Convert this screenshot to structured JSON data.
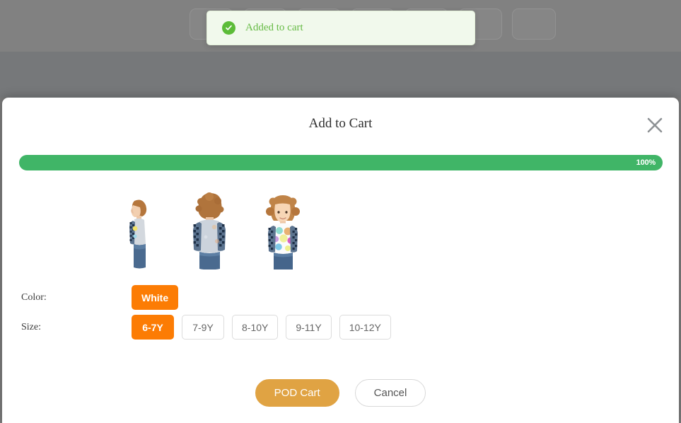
{
  "toast": {
    "icon": "check-circle-icon",
    "message": "Added to cart",
    "bg_color": "#f1f9ec",
    "text_color": "#67bb46",
    "icon_color": "#5cbc38"
  },
  "modal": {
    "title": "Add to Cart",
    "close_icon": "close-icon",
    "progress": {
      "percent": 100,
      "label": "100%",
      "fill_color": "#40b567"
    },
    "thumbnails": [
      {
        "alt": "product-side-view"
      },
      {
        "alt": "product-back-view"
      },
      {
        "alt": "product-front-view"
      }
    ],
    "options": [
      {
        "label": "Color:",
        "name": "color",
        "values": [
          {
            "text": "White",
            "selected": true
          }
        ]
      },
      {
        "label": "Size:",
        "name": "size",
        "values": [
          {
            "text": "6-7Y",
            "selected": true
          },
          {
            "text": "7-9Y",
            "selected": false
          },
          {
            "text": "8-10Y",
            "selected": false
          },
          {
            "text": "9-11Y",
            "selected": false
          },
          {
            "text": "10-12Y",
            "selected": false
          }
        ]
      }
    ],
    "footer": {
      "primary_label": "POD Cart",
      "secondary_label": "Cancel",
      "primary_color": "#e0a343"
    }
  },
  "background": {
    "overlay_color": "#7b7b7b"
  }
}
